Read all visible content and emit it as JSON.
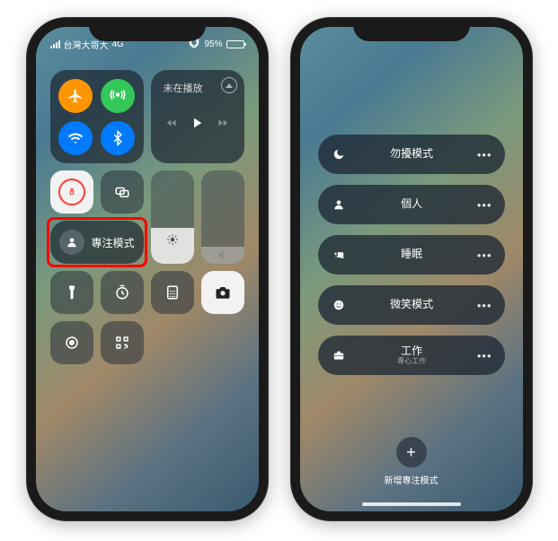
{
  "statusbar": {
    "carrier": "台灣大哥大",
    "signal": "4G",
    "battery_pct": "95%",
    "battery_fill_pct": 95
  },
  "now_playing": {
    "title": "未在播放"
  },
  "control_center": {
    "focus_label": "專注模式",
    "brightness_value_pct": 38,
    "volume_value_pct": 18
  },
  "focus_page": {
    "modes": [
      {
        "icon": "moon-icon",
        "label": "勿擾模式",
        "sub": ""
      },
      {
        "icon": "person-icon",
        "label": "個人",
        "sub": ""
      },
      {
        "icon": "bed-icon",
        "label": "睡眠",
        "sub": ""
      },
      {
        "icon": "smile-icon",
        "label": "微笑模式",
        "sub": ""
      },
      {
        "icon": "briefcase-icon",
        "label": "工作",
        "sub": "專心工作"
      }
    ],
    "add_label": "新增專注模式"
  }
}
